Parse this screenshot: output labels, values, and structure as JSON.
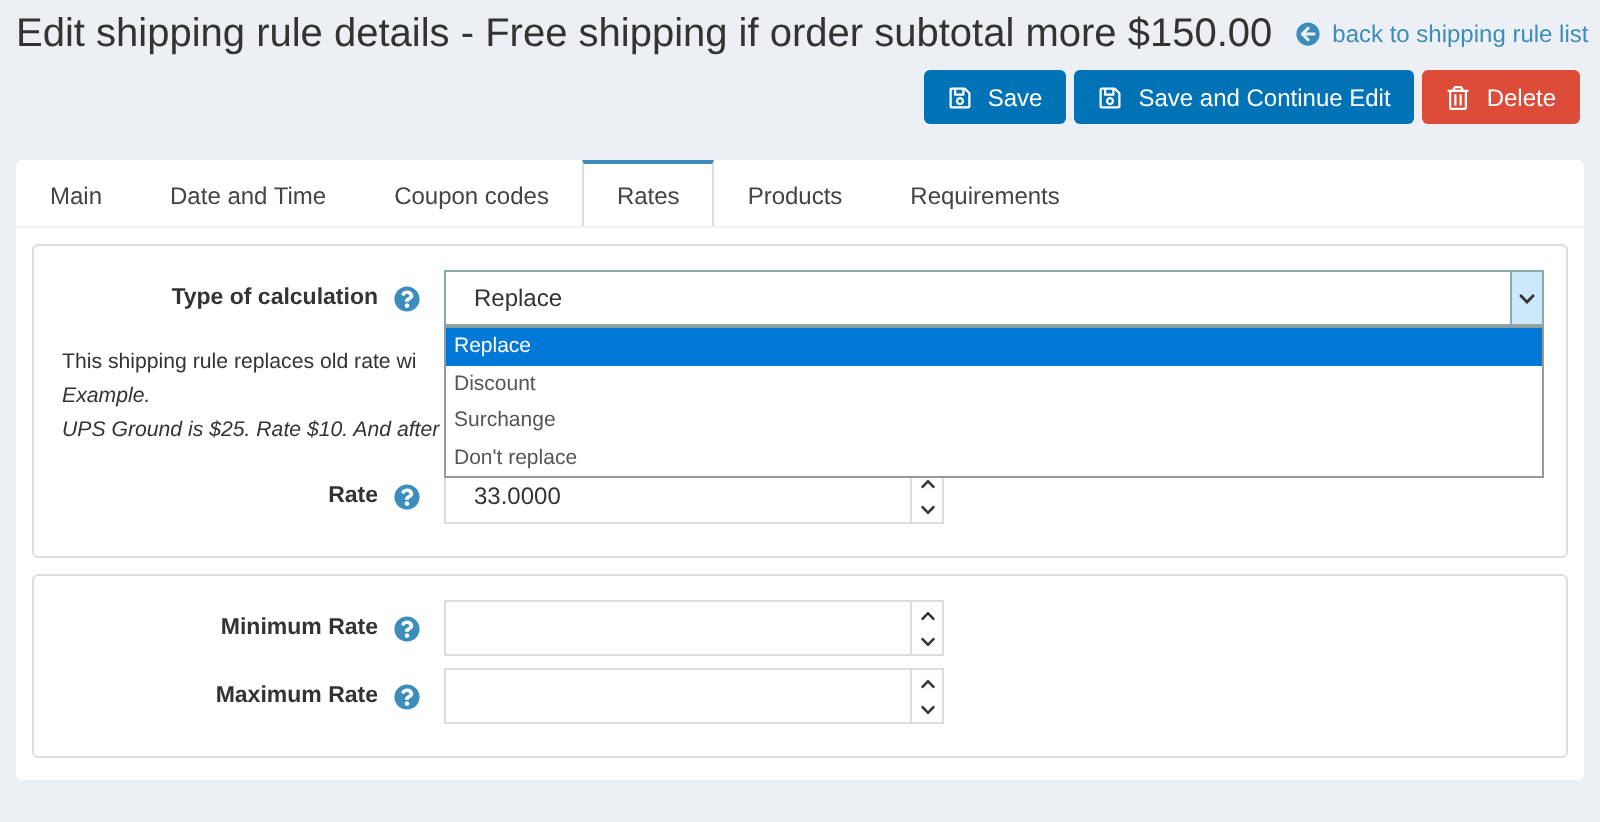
{
  "title": "Edit shipping rule details - Free shipping if order subtotal more $150.00",
  "back_link": "back to shipping rule list",
  "buttons": [
    {
      "label": "Save",
      "kind": "save"
    },
    {
      "label": "Save and Continue Edit",
      "kind": "save"
    },
    {
      "label": "Delete",
      "kind": "delete"
    }
  ],
  "tabs": [
    {
      "label": "Main",
      "selected": false
    },
    {
      "label": "Date and Time",
      "selected": false
    },
    {
      "label": "Coupon codes",
      "selected": false
    },
    {
      "label": "Rates",
      "selected": true
    },
    {
      "label": "Products",
      "selected": false
    },
    {
      "label": "Requirements",
      "selected": false
    }
  ],
  "calculation": {
    "label": "Type of calculation",
    "value": "Replace",
    "expanded": true,
    "options": [
      {
        "label": "Replace",
        "selected": true
      },
      {
        "label": "Discount",
        "selected": false
      },
      {
        "label": "Surchange",
        "selected": false
      },
      {
        "label": "Don't replace",
        "selected": false
      }
    ]
  },
  "description": [
    "This shipping rule replaces old rate wi",
    "Example.",
    "UPS Ground is $25. Rate $10. And after"
  ],
  "rate": {
    "label": "Rate",
    "value": "33.0000"
  },
  "limits": [
    {
      "label": "Minimum Rate"
    },
    {
      "label": "Maximum Rate"
    }
  ]
}
